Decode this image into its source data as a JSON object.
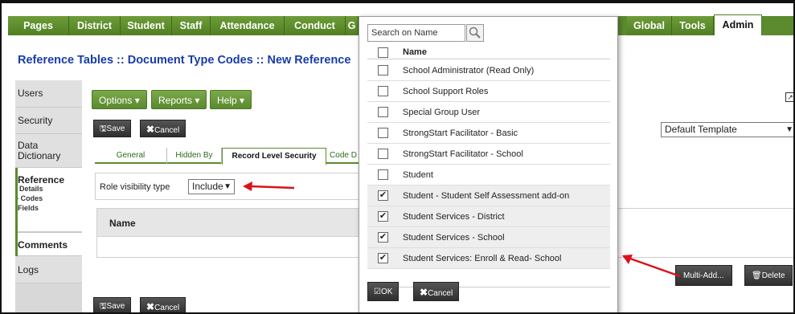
{
  "nav": {
    "tabs": [
      "Pages",
      "District",
      "Student",
      "Staff",
      "Attendance",
      "Conduct",
      "G",
      "Global",
      "Tools",
      "Admin"
    ],
    "active": "Admin"
  },
  "breadcrumb": "Reference Tables :: Document Type Codes :: New Reference",
  "sidebar": {
    "items": [
      "Users",
      "Security",
      "Data Dictionary",
      "Reference",
      "Comments",
      "Logs"
    ],
    "reference_sub": [
      "Details",
      "Codes",
      "Fields"
    ],
    "active_sub": "Codes"
  },
  "toolbar": {
    "options": "Options ▾",
    "reports": "Reports ▾",
    "help": "Help ▾",
    "save": "Save",
    "cancel": "Cancel"
  },
  "template_select": "Default Template",
  "subtabs": [
    "General",
    "Hidden By",
    "Record Level Security",
    "Code D"
  ],
  "role_visibility": {
    "label": "Role visibility type",
    "value": "Include"
  },
  "table": {
    "header": "Name"
  },
  "right_buttons": {
    "multi_add": "Multi-Add...",
    "delete": "Delete"
  },
  "popup": {
    "search_placeholder": "Search on Name",
    "column": "Name",
    "rows": [
      {
        "label": "School Administrator (Read Only)",
        "checked": false
      },
      {
        "label": "School Support Roles",
        "checked": false
      },
      {
        "label": "Special Group User",
        "checked": false
      },
      {
        "label": "StrongStart Facilitator - Basic",
        "checked": false
      },
      {
        "label": "StrongStart Facilitator - School",
        "checked": false
      },
      {
        "label": "Student",
        "checked": false
      },
      {
        "label": "Student - Student Self Assessment add-on",
        "checked": true
      },
      {
        "label": "Student Services - District",
        "checked": true
      },
      {
        "label": "Student Services - School",
        "checked": true
      },
      {
        "label": "Student Services: Enroll & Read- School",
        "checked": true
      }
    ],
    "ok": "OK",
    "cancel": "Cancel"
  },
  "colors": {
    "nav_green": "#5b8a2f",
    "title_blue": "#1a3ca8",
    "arrow_red": "#d9121b"
  },
  "icons": {
    "save": "save-icon",
    "cancel": "x-icon",
    "search": "magnifier-icon",
    "ok": "check-icon",
    "delete": "trash-icon",
    "popout": "external-window-icon"
  }
}
